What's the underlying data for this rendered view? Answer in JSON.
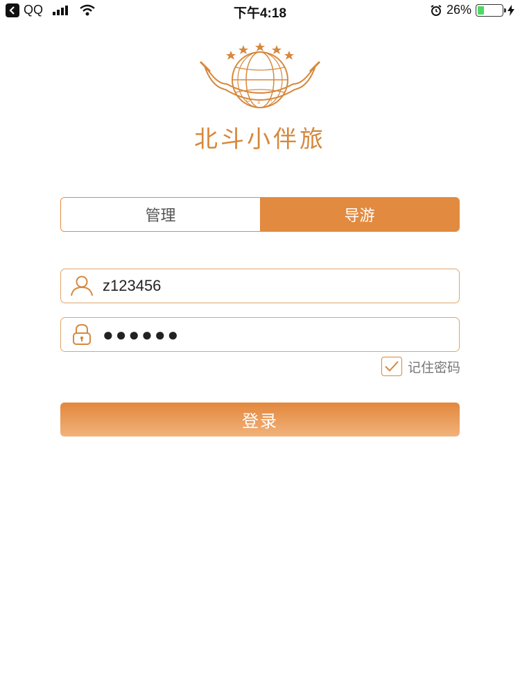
{
  "status_bar": {
    "carrier": "QQ",
    "time": "下午4:18",
    "battery_percent": "26%",
    "battery_level": 0.26,
    "icons": [
      "back-arrow-icon",
      "signal-icon",
      "wifi-icon",
      "alarm-icon",
      "battery-icon",
      "charging-icon"
    ]
  },
  "app": {
    "name": "北斗小伴旅",
    "logo_icon": "globe-logo-icon",
    "brand_color": "#e28a3f"
  },
  "role_tabs": {
    "items": [
      {
        "label": "管理",
        "selected": false
      },
      {
        "label": "导游",
        "selected": true
      }
    ]
  },
  "login": {
    "username": {
      "value": "z123456",
      "icon": "user-icon"
    },
    "password": {
      "value": "●●●●●●",
      "icon": "lock-icon"
    },
    "remember": {
      "label": "记住密码",
      "checked": true
    },
    "submit_label": "登录"
  }
}
